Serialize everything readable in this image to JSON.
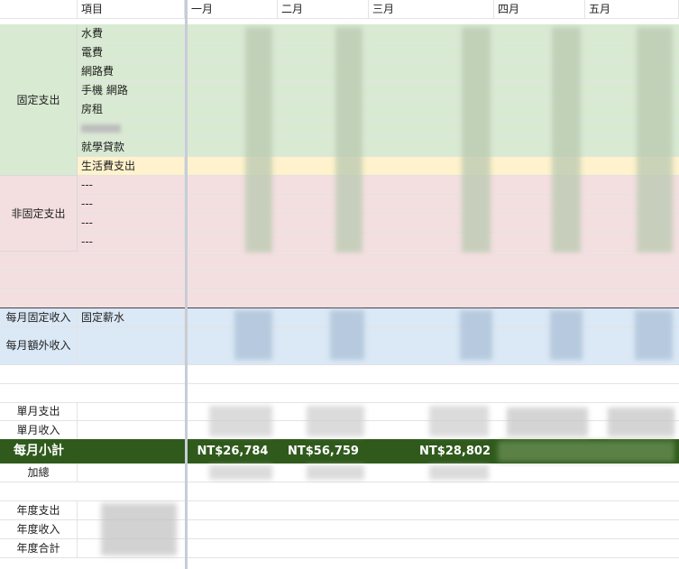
{
  "header": {
    "item_col": "項目",
    "months": [
      "一月",
      "二月",
      "三月",
      "四月",
      "五月"
    ]
  },
  "fixed_expense": {
    "group_label": "固定支出",
    "items": [
      "水費",
      "電費",
      "網路費",
      "手機 網路",
      "房租",
      "",
      "就學貸款",
      "生活費支出"
    ]
  },
  "variable_expense": {
    "group_label": "非固定支出",
    "items": [
      "---",
      "---",
      "---",
      "---"
    ]
  },
  "income": {
    "fixed_label": "每月固定收入",
    "fixed_item": "固定薪水",
    "extra_label": "每月額外收入"
  },
  "summary": {
    "monthly_expense": "單月支出",
    "monthly_income": "單月收入",
    "monthly_subtotal": "每月小計",
    "cumulative": "加總",
    "subtotals": [
      "NT$26,784",
      "NT$56,759",
      "NT$28,802"
    ]
  },
  "annual": {
    "expense": "年度支出",
    "income": "年度收入",
    "total": "年度合計"
  },
  "colors": {
    "fixed_bg": "#d9ead3",
    "living_bg": "#fff2cc",
    "variable_bg": "#f4dfe0",
    "income_bg": "#dbe8f6",
    "subtotal_bg": "#2f5a1c"
  }
}
